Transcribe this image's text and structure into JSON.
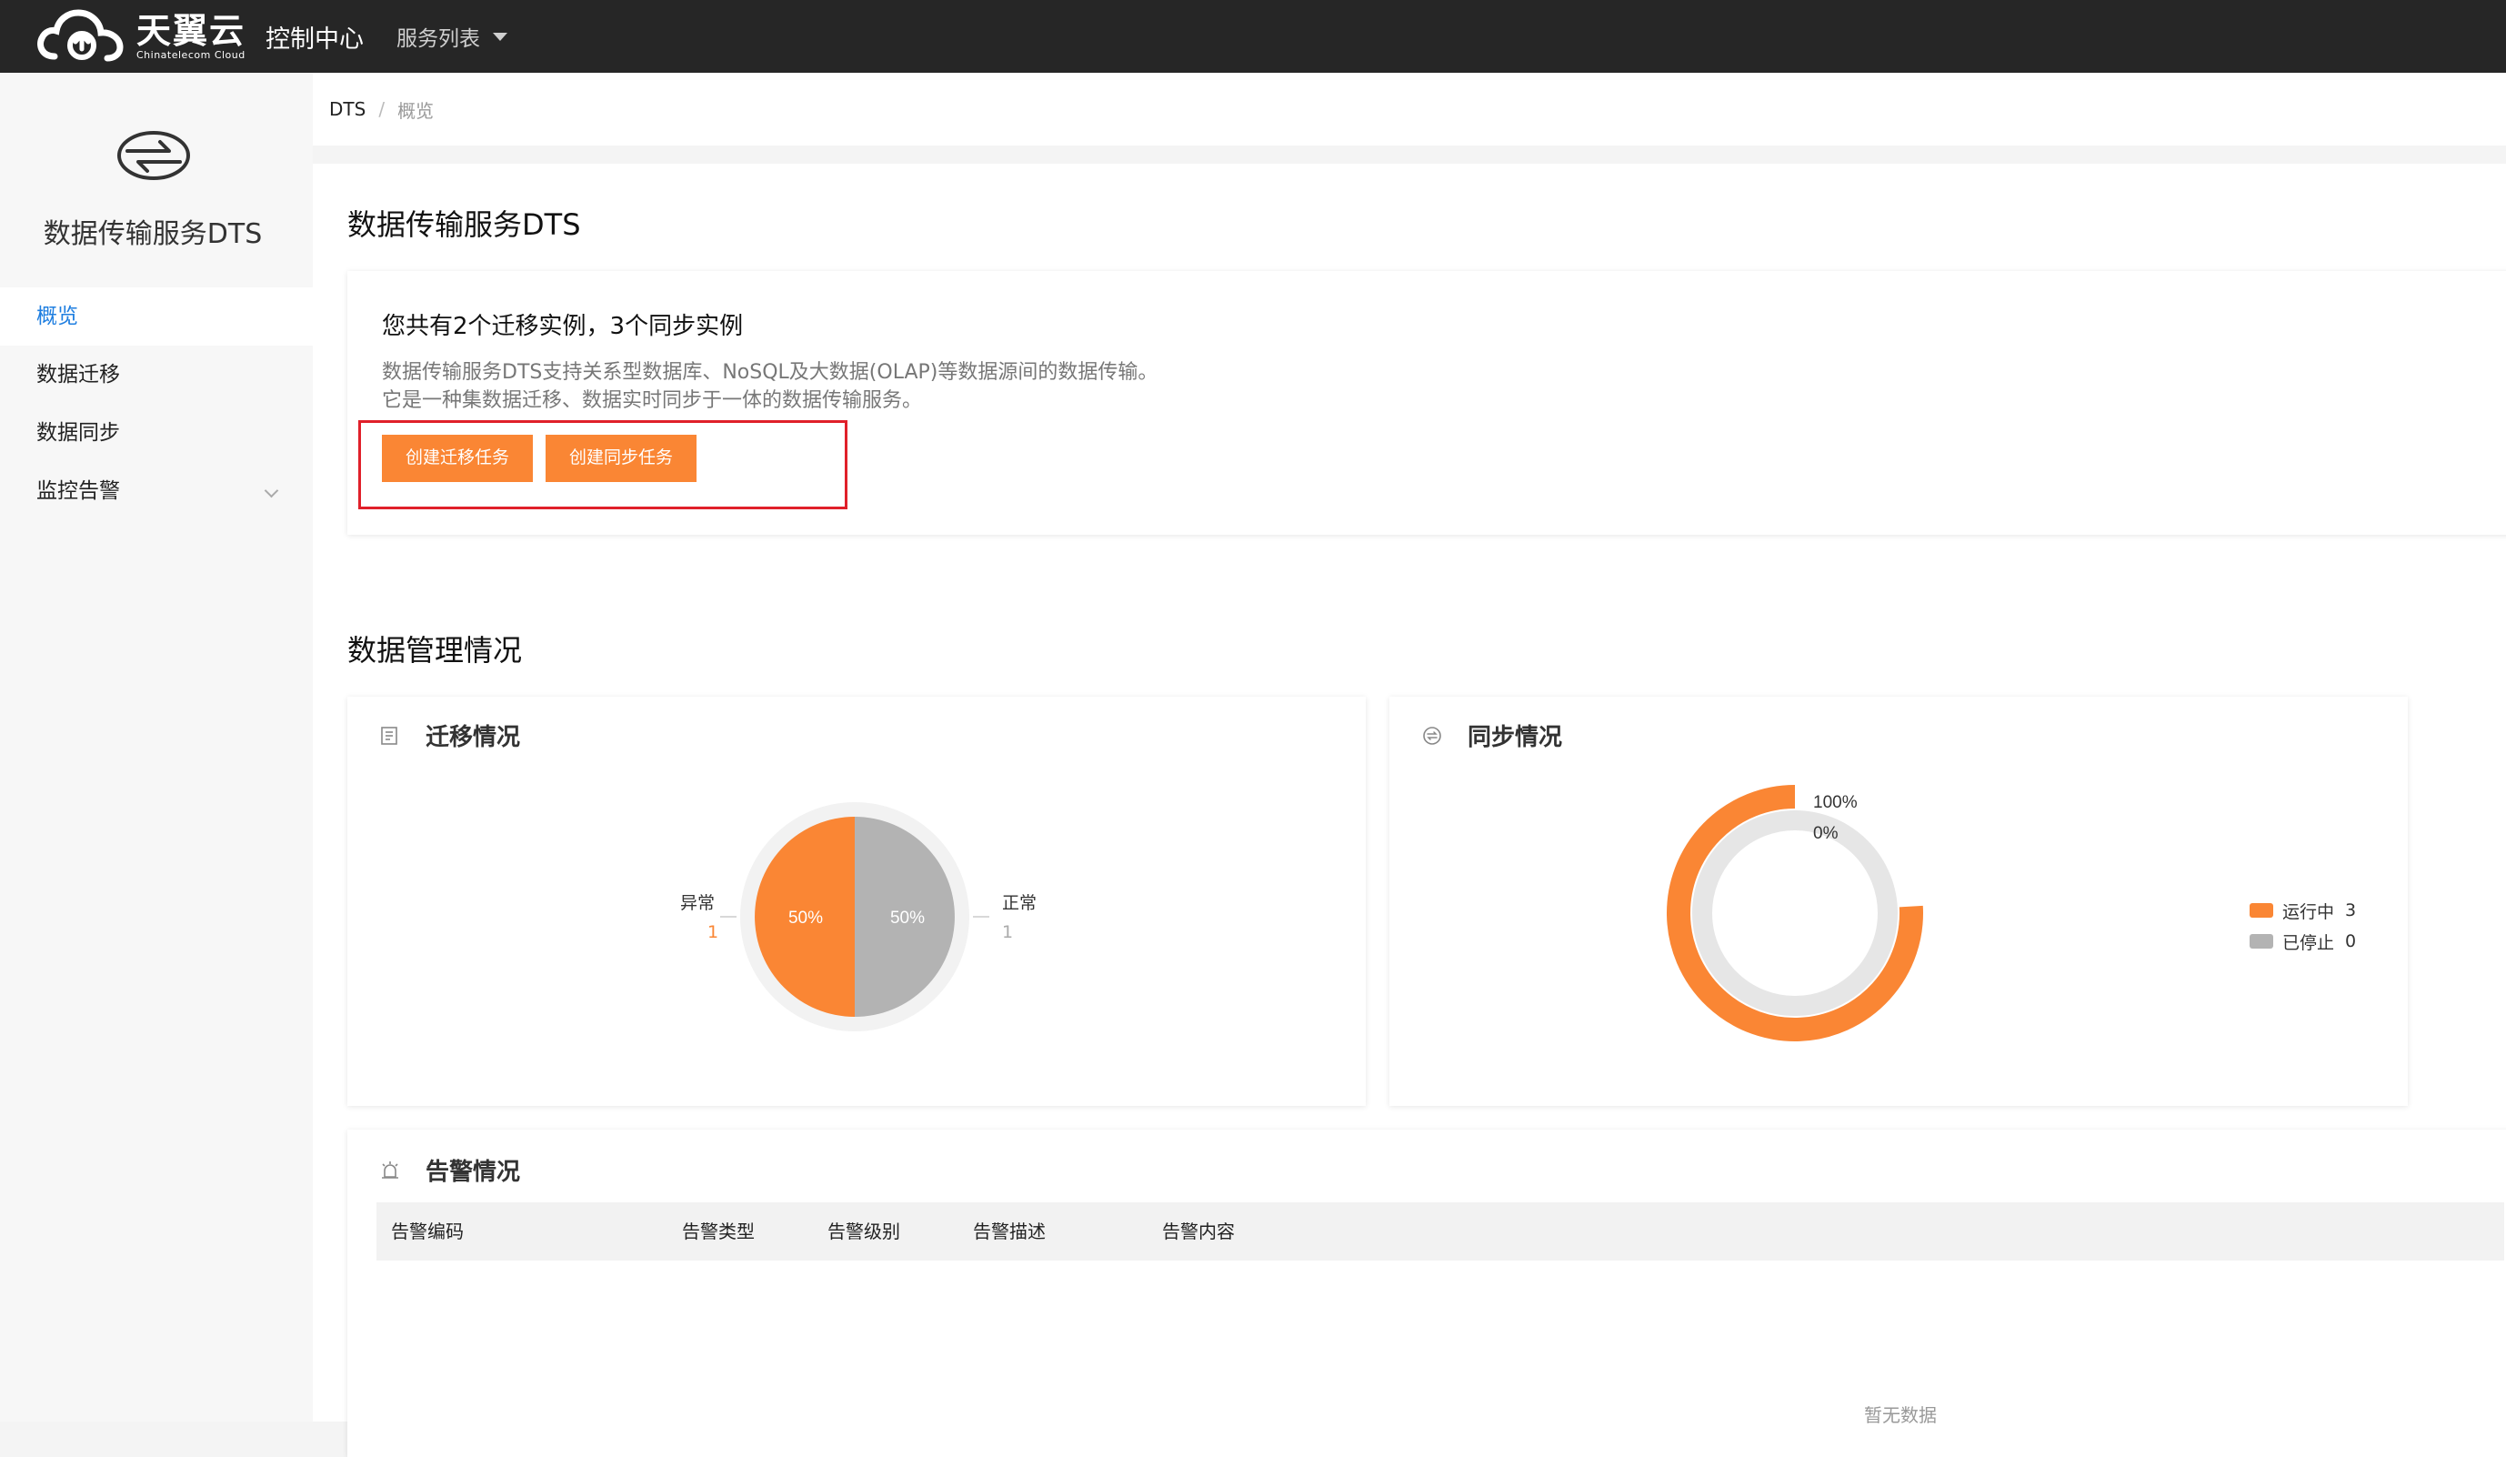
{
  "topbar": {
    "logo_cn": "天翼云",
    "logo_en": "Chinatelecom Cloud",
    "console_title": "控制中心",
    "service_list": "服务列表"
  },
  "sidebar": {
    "title": "数据传输服务DTS",
    "items": [
      {
        "label": "概览"
      },
      {
        "label": "数据迁移"
      },
      {
        "label": "数据同步"
      },
      {
        "label": "监控告警"
      }
    ]
  },
  "breadcrumb": {
    "root": "DTS",
    "separator": "/",
    "current": "概览"
  },
  "page": {
    "title": "数据传输服务DTS",
    "summary": "您共有2个迁移实例，3个同步实例",
    "description": "数据传输服务DTS支持关系型数据库、NoSQL及大数据(OLAP)等数据源间的数据传输。它是一种集数据迁移、数据实时同步于一体的数据传输服务。",
    "btn_migrate": "创建迁移任务",
    "btn_sync": "创建同步任务",
    "section_title": "数据管理情况"
  },
  "migration_panel": {
    "title": "迁移情况",
    "abnormal_label": "异常",
    "abnormal_count": "1",
    "normal_label": "正常",
    "normal_count": "1",
    "abnormal_pct": "50%",
    "normal_pct": "50%"
  },
  "sync_panel": {
    "title": "同步情况",
    "outer_pct": "100%",
    "inner_pct": "0%",
    "legend": [
      {
        "label": "运行中",
        "value": "3"
      },
      {
        "label": "已停止",
        "value": "0"
      }
    ]
  },
  "alert_panel": {
    "title": "告警情况",
    "columns": [
      "告警编码",
      "告警类型",
      "告警级别",
      "告警描述",
      "告警内容"
    ],
    "empty_text": "暂无数据"
  },
  "colors": {
    "accent": "#fa8634",
    "grey": "#b3b3b3",
    "active_link": "#1e7ee0",
    "highlight": "#e0202a"
  },
  "chart_data": [
    {
      "type": "pie",
      "title": "迁移情况",
      "categories": [
        "异常",
        "正常"
      ],
      "values": [
        1,
        1
      ],
      "percent_labels": [
        "50%",
        "50%"
      ],
      "colors": [
        "#fa8634",
        "#b3b3b3"
      ]
    },
    {
      "type": "pie",
      "title": "同步情况",
      "categories": [
        "运行中",
        "已停止"
      ],
      "values": [
        3,
        0
      ],
      "percent_labels": [
        "100%",
        "0%"
      ],
      "colors": [
        "#fa8634",
        "#b3b3b3"
      ],
      "legend": "right"
    }
  ]
}
